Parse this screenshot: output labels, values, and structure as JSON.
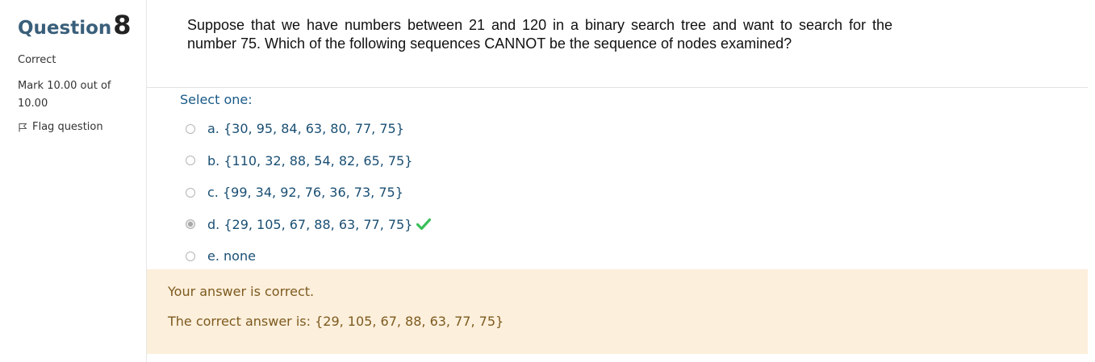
{
  "info": {
    "question_word": "Question",
    "question_number": "8",
    "state": "Correct",
    "grade": "Mark 10.00 out of 10.00",
    "flag_label": "Flag question"
  },
  "question": {
    "text": "Suppose that we have numbers between 21 and 120 in a binary search tree and want to search for the number 75. Which of the following sequences CANNOT be the sequence of nodes examined?",
    "prompt": "Select one:",
    "options": [
      {
        "label": "a. {30, 95, 84, 63, 80, 77, 75}",
        "selected": false
      },
      {
        "label": "b. {110, 32, 88, 54, 82, 65, 75}",
        "selected": false
      },
      {
        "label": "c. {99, 34, 92, 76, 36, 73, 75}",
        "selected": false
      },
      {
        "label": "d. {29, 105, 67, 88, 63, 77, 75}",
        "selected": true,
        "mark_icon": "green-checkmark-icon"
      },
      {
        "label": "e. none",
        "selected": false
      }
    ]
  },
  "feedback": {
    "status_message": "Your answer is correct.",
    "correct_answer": "The correct answer is: {29, 105, 67, 88, 63, 77, 75}"
  },
  "colors": {
    "feedback_bg": "#fcefdc",
    "feedback_text": "#7d5a1e",
    "option_text": "#1a4f73",
    "check_green": "#3ac05a"
  }
}
